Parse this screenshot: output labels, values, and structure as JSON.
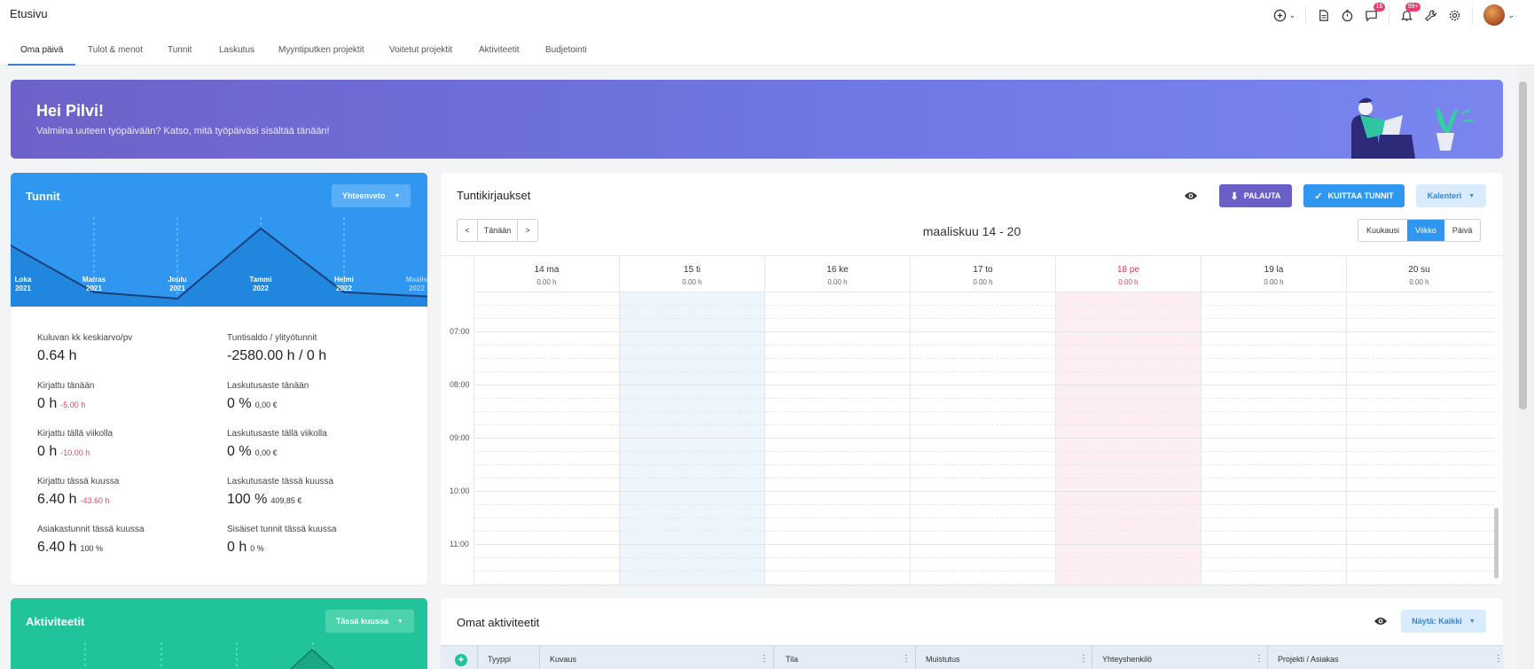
{
  "header": {
    "title": "Etusivu",
    "chat_badge": "16",
    "notif_badge": "99+"
  },
  "tabs": [
    "Oma päivä",
    "Tulot & menot",
    "Tunnit",
    "Laskutus",
    "Myyntiputken projektit",
    "Voitetut projektit",
    "Aktiviteetit",
    "Budjetointi"
  ],
  "banner": {
    "greeting": "Hei Pilvi!",
    "subtitle": "Valmiina uuteen työpäivään? Katso, mitä työpäiväsi sisältää tänään!"
  },
  "hours_card": {
    "title": "Tunnit",
    "dropdown": "Yhteenveto",
    "chart_data": {
      "type": "area",
      "x": [
        "Loka 2021",
        "Marras 2021",
        "Joulu 2021",
        "Tammi 2022",
        "Helmi 2022",
        "Maalis 2022"
      ],
      "values": [
        5,
        0.6,
        0,
        6.6,
        0.6,
        0.2
      ]
    },
    "stats": [
      {
        "label": "Kuluvan kk keskiarvo/pv",
        "value": "0.64 h",
        "sub": "",
        "sub_color": "grey"
      },
      {
        "label": "Tuntisaldo / ylityötunnit",
        "value": "-2580.00 h / 0 h",
        "sub": "",
        "sub_color": "grey"
      },
      {
        "label": "Kirjattu tänään",
        "value": "0 h",
        "sub": "-5.00 h",
        "sub_color": "red"
      },
      {
        "label": "Laskutusaste tänään",
        "value": "0 %",
        "sub": "0,00 €",
        "sub_color": "grey"
      },
      {
        "label": "Kirjattu tällä viikolla",
        "value": "0 h",
        "sub": "-10.00 h",
        "sub_color": "red"
      },
      {
        "label": "Laskutusaste tällä viikolla",
        "value": "0 %",
        "sub": "0,00 €",
        "sub_color": "grey"
      },
      {
        "label": "Kirjattu tässä kuussa",
        "value": "6.40 h",
        "sub": "-43.60 h",
        "sub_color": "red"
      },
      {
        "label": "Laskutusaste tässä kuussa",
        "value": "100 %",
        "sub": "409,85 €",
        "sub_color": "grey"
      },
      {
        "label": "Asiakastunnit tässä kuussa",
        "value": "6.40 h",
        "sub": "100 %",
        "sub_color": "grey"
      },
      {
        "label": "Sisäiset tunnit tässä kuussa",
        "value": "0 h",
        "sub": "0 %",
        "sub_color": "grey"
      }
    ]
  },
  "activities_card": {
    "title": "Aktiviteetit",
    "dropdown": "Tässä kuussa"
  },
  "calendar": {
    "title": "Tuntikirjaukset",
    "return_btn": "PALAUTA",
    "approve_btn": "KUITTAA TUNNIT",
    "calendar_dropdown": "Kalenteri",
    "prev": "<",
    "today": "Tänään",
    "next": ">",
    "range": "maaliskuu 14 - 20",
    "views": [
      "Kuukausi",
      "Viikko",
      "Päivä"
    ],
    "days": [
      {
        "name": "14 ma",
        "hours": "0.00 h"
      },
      {
        "name": "15 ti",
        "hours": "0.00 h"
      },
      {
        "name": "16 ke",
        "hours": "0.00 h"
      },
      {
        "name": "17 to",
        "hours": "0.00 h"
      },
      {
        "name": "18 pe",
        "hours": "0.00 h"
      },
      {
        "name": "19 la",
        "hours": "0.00 h"
      },
      {
        "name": "20 su",
        "hours": "0.00 h"
      }
    ],
    "times": [
      "07:00",
      "08:00",
      "09:00",
      "10:00",
      "11:00"
    ]
  },
  "own_activities": {
    "title": "Omat aktiviteetit",
    "filter": "Näytä: Kaikki",
    "columns": [
      "Tyyppi",
      "Kuvaus",
      "Tila",
      "Muistutus",
      "Yhteyshenkilö",
      "Projekti / Asiakas"
    ]
  },
  "colors": {
    "blue": "#2f97f0",
    "green": "#21c49a",
    "purple": "#6a5fc7",
    "weekend_highlight": "#fdeef3",
    "today_highlight": "#eef6fd"
  }
}
